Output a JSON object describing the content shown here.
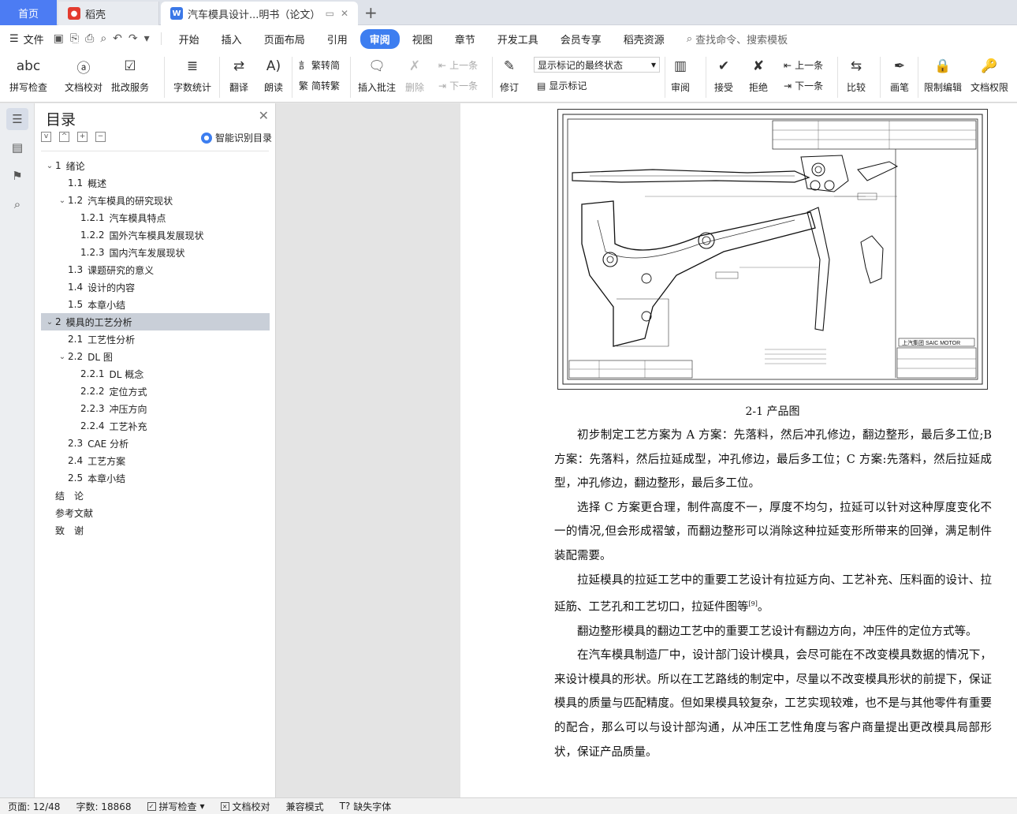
{
  "tabs": {
    "home": "首页",
    "daoke": "稻壳",
    "doc": "汽车模具设计...明书（论文）"
  },
  "menu": {
    "file": "文件",
    "items": [
      "开始",
      "插入",
      "页面布局",
      "引用",
      "审阅",
      "视图",
      "章节",
      "开发工具",
      "会员专享",
      "稻壳资源"
    ],
    "active": "审阅",
    "search": "查找命令、搜索模板"
  },
  "ribbon": {
    "spell_check": "拼写检查",
    "doc_proof": "文档校对",
    "annotate_service": "批改服务",
    "word_count": "字数统计",
    "translate": "翻译",
    "read_aloud": "朗读",
    "trad_convert": "繁转简",
    "simp_convert": "简转繁",
    "insert_comment": "插入批注",
    "delete": "删除",
    "prev_comment": "上一条",
    "next_comment": "下一条",
    "track_changes": "修订",
    "markup_state": "显示标记的最终状态",
    "show_markup": "显示标记",
    "review": "审阅",
    "accept": "接受",
    "reject": "拒绝",
    "prev_change": "上一条",
    "next_change": "下一条",
    "compare": "比较",
    "pen": "画笔",
    "restrict_edit": "限制编辑",
    "doc_permission": "文档权限"
  },
  "toc": {
    "title": "目录",
    "smart": "智能识别目录",
    "items": [
      {
        "level": 1,
        "num": "1",
        "text": "绪论",
        "caret": "v"
      },
      {
        "level": 2,
        "num": "1.1",
        "text": "概述",
        "caret": ""
      },
      {
        "level": 2,
        "num": "1.2",
        "text": "汽车模具的研究现状",
        "caret": "v"
      },
      {
        "level": 3,
        "num": "1.2.1",
        "text": "汽车模具特点",
        "caret": ""
      },
      {
        "level": 3,
        "num": "1.2.2",
        "text": "国外汽车模具发展现状",
        "caret": ""
      },
      {
        "level": 3,
        "num": "1.2.3",
        "text": "国内汽车发展现状",
        "caret": ""
      },
      {
        "level": 2,
        "num": "1.3",
        "text": "课题研究的意义",
        "caret": ""
      },
      {
        "level": 2,
        "num": "1.4",
        "text": "设计的内容",
        "caret": ""
      },
      {
        "level": 2,
        "num": "1.5",
        "text": "本章小结",
        "caret": ""
      },
      {
        "level": 1,
        "num": "2",
        "text": "模具的工艺分析",
        "caret": "v",
        "selected": true
      },
      {
        "level": 2,
        "num": "2.1",
        "text": "工艺性分析",
        "caret": ""
      },
      {
        "level": 2,
        "num": "2.2",
        "text": "DL 图",
        "caret": "v"
      },
      {
        "level": 3,
        "num": "2.2.1",
        "text": "DL 概念",
        "caret": ""
      },
      {
        "level": 3,
        "num": "2.2.2",
        "text": "定位方式",
        "caret": ""
      },
      {
        "level": 3,
        "num": "2.2.3",
        "text": "冲压方向",
        "caret": ""
      },
      {
        "level": 3,
        "num": "2.2.4",
        "text": "工艺补充",
        "caret": ""
      },
      {
        "level": 2,
        "num": "2.3",
        "text": "CAE 分析",
        "caret": ""
      },
      {
        "level": 2,
        "num": "2.4",
        "text": "工艺方案",
        "caret": ""
      },
      {
        "level": 2,
        "num": "2.5",
        "text": "本章小结",
        "caret": ""
      },
      {
        "level": 1,
        "num": "",
        "text": "结　论",
        "caret": ""
      },
      {
        "level": 1,
        "num": "",
        "text": "参考文献",
        "caret": ""
      },
      {
        "level": 1,
        "num": "",
        "text": "致　谢",
        "caret": ""
      }
    ]
  },
  "document": {
    "figure_label": "上汽集团 SAIC MOTOR",
    "caption": "2-1 产品图",
    "paragraphs": [
      "初步制定工艺方案为 A 方案：先落料，然后冲孔修边，翻边整形，最后多工位;B 方案：先落料，然后拉延成型，冲孔修边，最后多工位；C 方案:先落料，然后拉延成型，冲孔修边，翻边整形，最后多工位。",
      "选择 C 方案更合理，制件高度不一，厚度不均匀，拉延可以针对这种厚度变化不一的情况,但会形成褶皱，而翻边整形可以消除这种拉延变形所带来的回弹，满足制件装配需要。",
      "拉延模具的拉延工艺中的重要工艺设计有拉延方向、工艺补充、压料面的设计、拉延筋、工艺孔和工艺切口，拉延件图等",
      "翻边整形模具的翻边工艺中的重要工艺设计有翻边方向，冲压件的定位方式等。",
      "在汽车模具制造厂中，设计部门设计模具，会尽可能在不改变模具数据的情况下，来设计模具的形状。所以在工艺路线的制定中，尽量以不改变模具形状的前提下，保证模具的质量与匹配精度。但如果模具较复杂，工艺实现较难，也不是与其他零件有重要的配合，那么可以与设计部沟通，从冲压工艺性角度与客户商量提出更改模具局部形状，保证产品质量。"
    ],
    "ref_mark": "[9]",
    "ref_tail": "。"
  },
  "status": {
    "page": "页面: 12/48",
    "words": "字数: 18868",
    "spell": "拼写检查",
    "proof": "文档校对",
    "compat": "兼容模式",
    "missing_font": "缺失字体"
  }
}
